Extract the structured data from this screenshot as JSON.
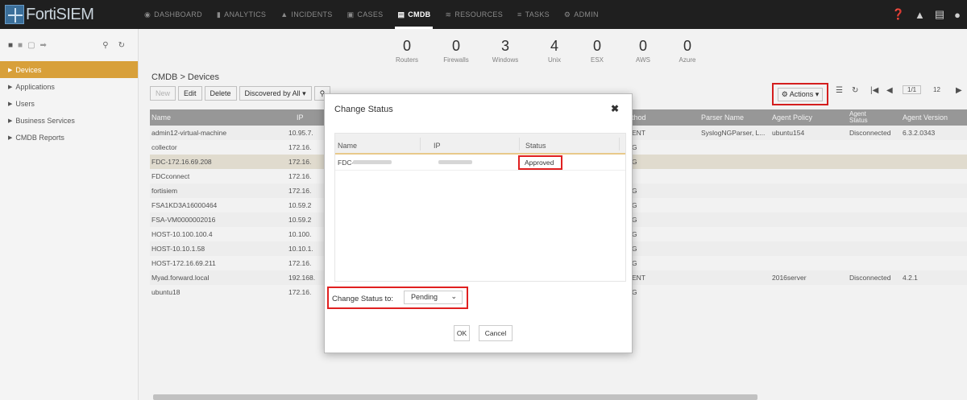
{
  "app": {
    "logo_text": "FortiSIEM"
  },
  "nav": [
    {
      "label": "DASHBOARD",
      "icon": "dashboard-icon"
    },
    {
      "label": "ANALYTICS",
      "icon": "bar-chart-icon"
    },
    {
      "label": "INCIDENTS",
      "icon": "bell-icon"
    },
    {
      "label": "CASES",
      "icon": "briefcase-icon"
    },
    {
      "label": "CMDB",
      "icon": "database-icon"
    },
    {
      "label": "RESOURCES",
      "icon": "line-chart-icon"
    },
    {
      "label": "TASKS",
      "icon": "list-icon"
    },
    {
      "label": "ADMIN",
      "icon": "gears-icon"
    }
  ],
  "nav_active": "CMDB",
  "sidebar": {
    "items": [
      {
        "label": "Devices"
      },
      {
        "label": "Applications"
      },
      {
        "label": "Users"
      },
      {
        "label": "Business Services"
      },
      {
        "label": "CMDB Reports"
      }
    ]
  },
  "stats": [
    {
      "count": "0",
      "label": "Routers"
    },
    {
      "count": "0",
      "label": "Firewalls"
    },
    {
      "count": "3",
      "label": "Windows"
    },
    {
      "count": "4",
      "label": "Unix"
    },
    {
      "count": "0",
      "label": "ESX"
    },
    {
      "count": "0",
      "label": "AWS"
    },
    {
      "count": "0",
      "label": "Azure"
    }
  ],
  "breadcrumb": "CMDB > Devices",
  "toolbar": {
    "new": "New",
    "edit": "Edit",
    "delete": "Delete",
    "discovered": "Discovered by All ▾",
    "actions": "Actions ▾",
    "pager": "1/1",
    "page_size": "12"
  },
  "grid": {
    "columns": [
      "Name",
      "IP",
      "thod",
      "Parser Name",
      "Agent Policy",
      "Agent Status",
      "Agent Version"
    ],
    "rows": [
      {
        "name": "admin12-virtual-machine",
        "ip": "10.95.7.",
        "method": "ENT",
        "parser": "SyslogNGParser, L...",
        "policy": "ubuntu154",
        "status": "Disconnected",
        "version": "6.3.2.0343"
      },
      {
        "name": "collector",
        "ip": "172.16.",
        "method": "G",
        "parser": "",
        "policy": "",
        "status": "",
        "version": ""
      },
      {
        "name": "FDC-172.16.69.208",
        "ip": "172.16.",
        "method": "G",
        "parser": "",
        "policy": "",
        "status": "",
        "version": ""
      },
      {
        "name": "FDCconnect",
        "ip": "172.16.",
        "method": "",
        "parser": "",
        "policy": "",
        "status": "",
        "version": ""
      },
      {
        "name": "fortisiem",
        "ip": "172.16.",
        "method": "G",
        "parser": "",
        "policy": "",
        "status": "",
        "version": ""
      },
      {
        "name": "FSA1KD3A16000464",
        "ip": "10.59.2",
        "method": "G",
        "parser": "",
        "policy": "",
        "status": "",
        "version": ""
      },
      {
        "name": "FSA-VM0000002016",
        "ip": "10.59.2",
        "method": "G",
        "parser": "",
        "policy": "",
        "status": "",
        "version": ""
      },
      {
        "name": "HOST-10.100.100.4",
        "ip": "10.100.",
        "method": "G",
        "parser": "",
        "policy": "",
        "status": "",
        "version": ""
      },
      {
        "name": "HOST-10.10.1.58",
        "ip": "10.10.1.",
        "method": "G",
        "parser": "",
        "policy": "",
        "status": "",
        "version": ""
      },
      {
        "name": "HOST-172.16.69.211",
        "ip": "172.16.",
        "method": "G",
        "parser": "",
        "policy": "",
        "status": "",
        "version": ""
      },
      {
        "name": "Myad.forward.local",
        "ip": "192.168.",
        "method": "ENT",
        "parser": "",
        "policy": "2016server",
        "status": "Disconnected",
        "version": "4.2.1"
      },
      {
        "name": "ubuntu18",
        "ip": "172.16.",
        "method": "G",
        "parser": "",
        "policy": "",
        "status": "",
        "version": ""
      }
    ]
  },
  "modal": {
    "title": "Change Status",
    "columns": [
      "Name",
      "IP",
      "Status"
    ],
    "row": {
      "name": "FDC-",
      "status": "Approved"
    },
    "change_label": "Change Status to:",
    "change_value": "Pending",
    "ok": "OK",
    "cancel": "Cancel"
  }
}
